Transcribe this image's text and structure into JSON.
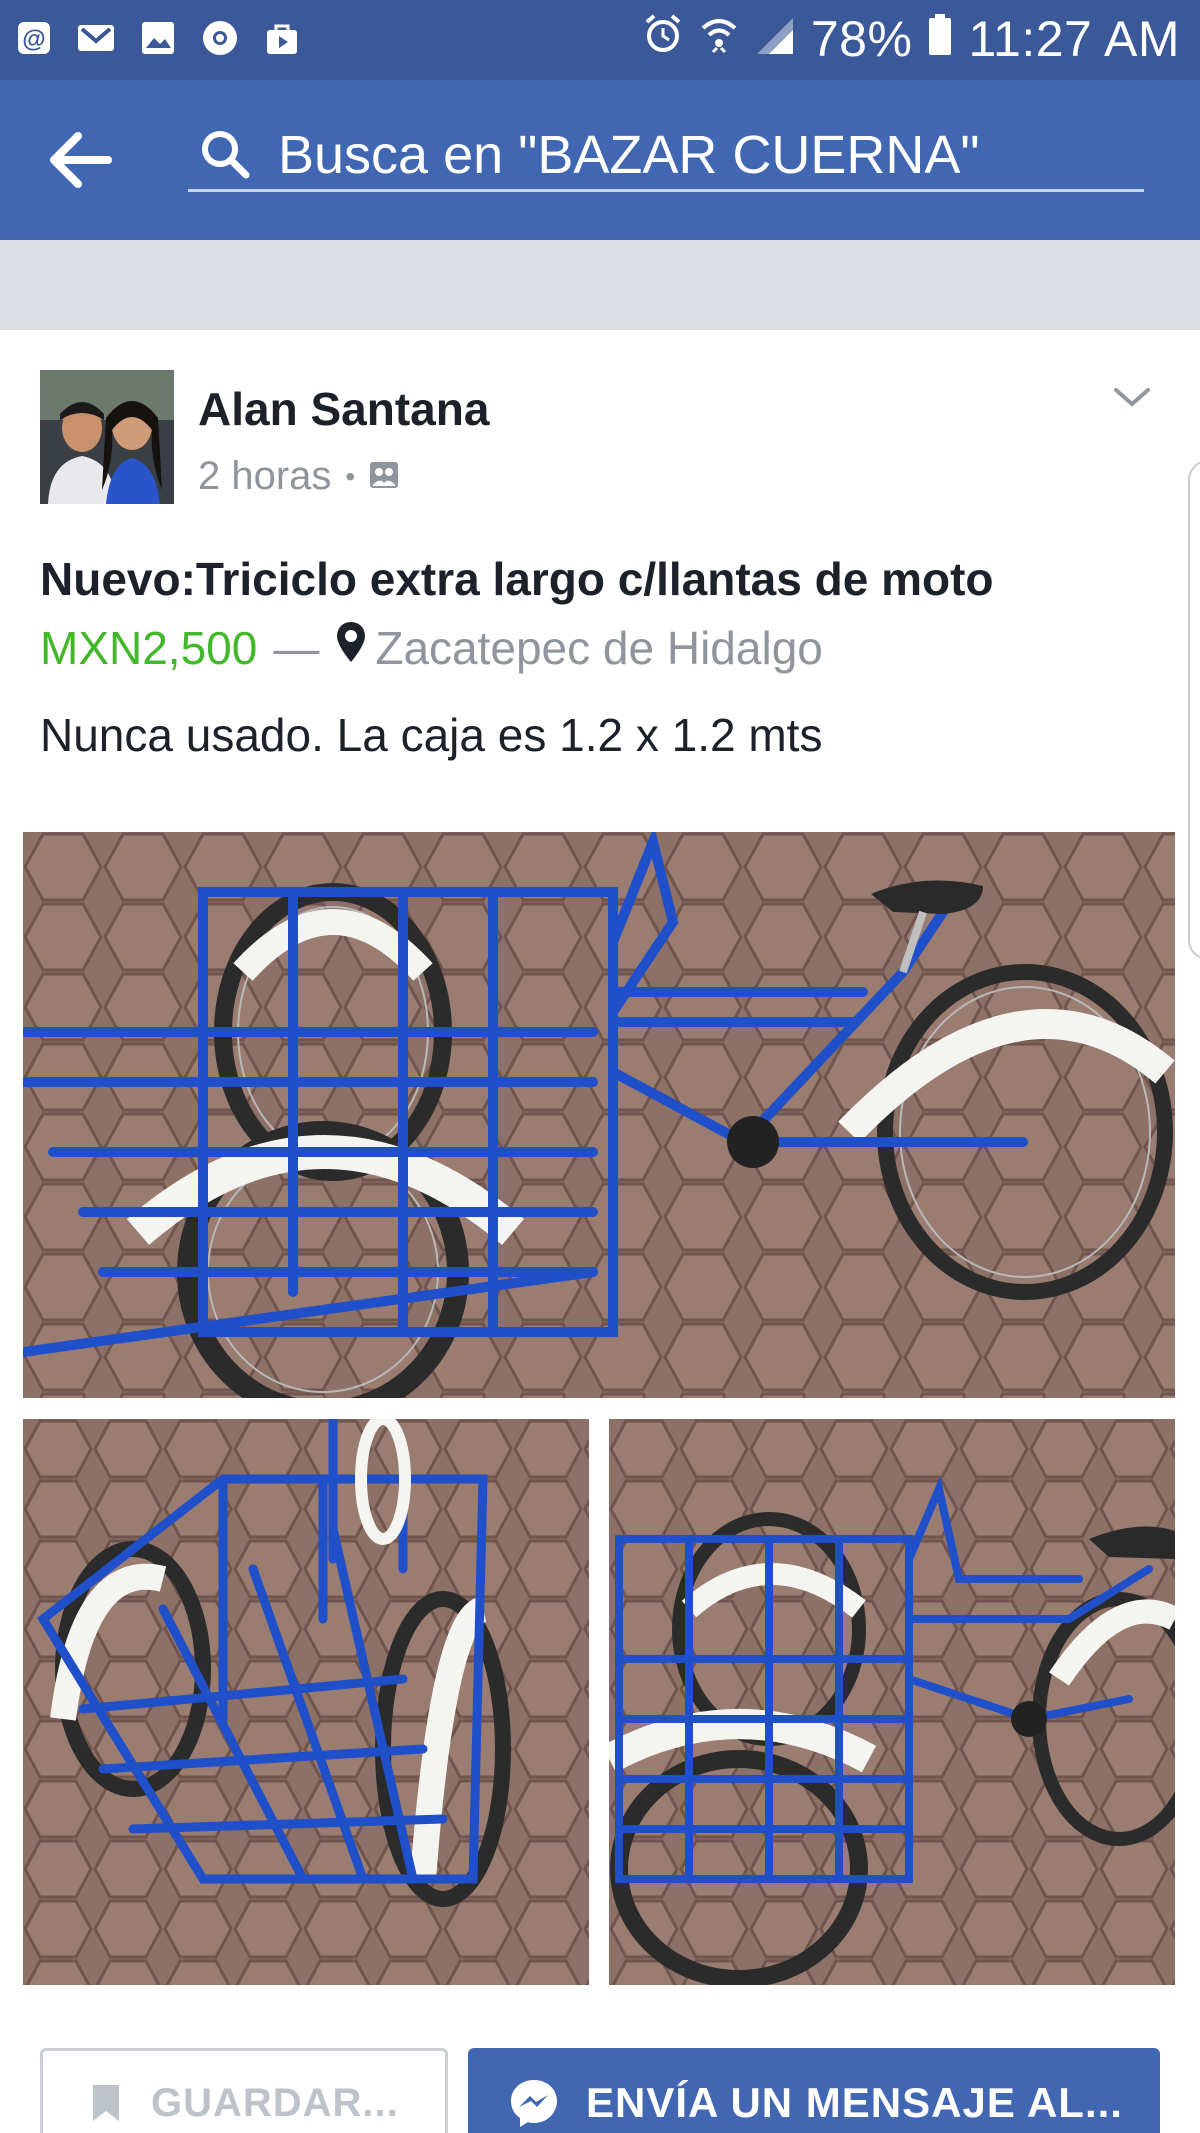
{
  "status_bar": {
    "left_icons": [
      "at-icon",
      "gmail-icon",
      "gallery-icon",
      "chrome-icon",
      "bag-icon"
    ],
    "battery": "78%",
    "time": "11:27 AM"
  },
  "search": {
    "placeholder": "Busca en \"BAZAR CUERNA\""
  },
  "post": {
    "author": "Alan Santana",
    "time": "2 horas",
    "separator": "•",
    "title": "Nuevo:Triciclo extra largo c/llantas de moto",
    "price": "MXN2,500",
    "dash": "—",
    "location": "Zacatepec de Hidalgo",
    "description": "Nunca usado. La caja es 1.2 x 1.2 mts"
  },
  "actions": {
    "save_label": "GUARDAR...",
    "message_label": "ENVÍA UN MENSAJE AL..."
  },
  "colors": {
    "brand_blue": "#4267b2",
    "status_blue": "#3b5998",
    "price_green": "#42b72a",
    "tricycle_blue": "#1f4fc9"
  }
}
